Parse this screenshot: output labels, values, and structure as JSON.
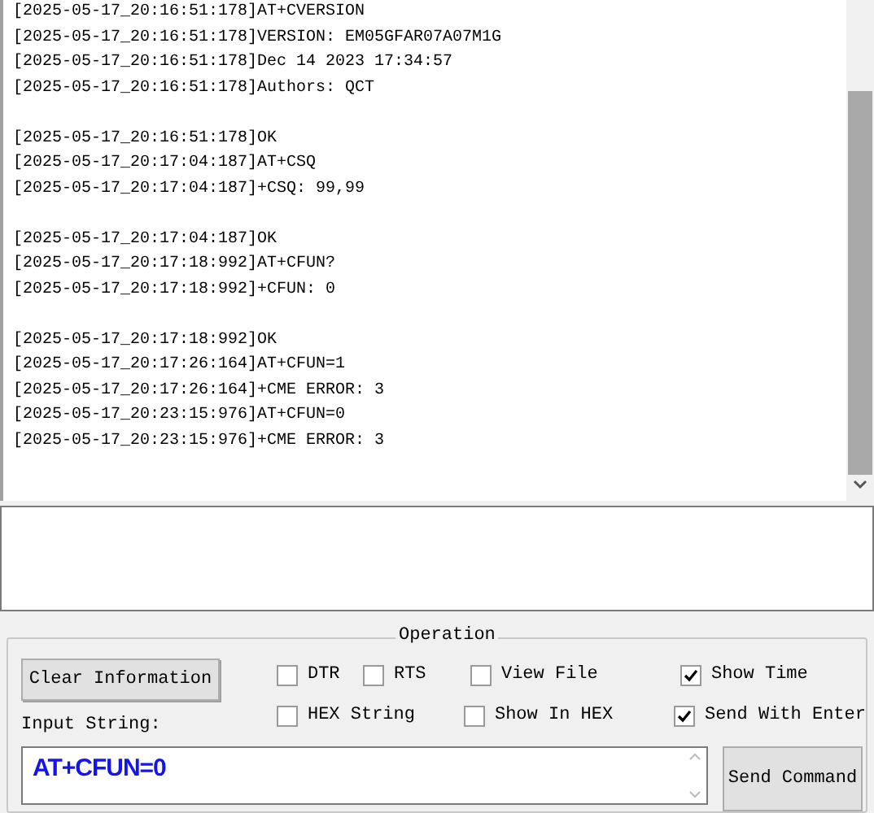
{
  "log": {
    "groups": [
      [
        "[2025-05-17_20:16:51:178]AT+CVERSION",
        "[2025-05-17_20:16:51:178]VERSION: EM05GFAR07A07M1G",
        "[2025-05-17_20:16:51:178]Dec 14 2023 17:34:57",
        "[2025-05-17_20:16:51:178]Authors: QCT"
      ],
      [
        "[2025-05-17_20:16:51:178]OK",
        "[2025-05-17_20:17:04:187]AT+CSQ",
        "[2025-05-17_20:17:04:187]+CSQ: 99,99"
      ],
      [
        "[2025-05-17_20:17:04:187]OK",
        "[2025-05-17_20:17:18:992]AT+CFUN?",
        "[2025-05-17_20:17:18:992]+CFUN: 0"
      ],
      [
        "[2025-05-17_20:17:18:992]OK",
        "[2025-05-17_20:17:26:164]AT+CFUN=1",
        "[2025-05-17_20:17:26:164]+CME ERROR: 3",
        "[2025-05-17_20:23:15:976]AT+CFUN=0",
        "[2025-05-17_20:23:15:976]+CME ERROR: 3"
      ]
    ]
  },
  "operation": {
    "title": "Operation",
    "clear_button": "Clear Information",
    "input_label": "Input String:",
    "input_value": "AT+CFUN=0",
    "send_button": "Send Command",
    "options": [
      {
        "label": "DTR",
        "checked": false
      },
      {
        "label": "RTS",
        "checked": false
      },
      {
        "label": "View File",
        "checked": false
      },
      {
        "label": "Show Time",
        "checked": true
      },
      {
        "label": "HEX String",
        "checked": false
      },
      {
        "label": "Show In HEX",
        "checked": false
      },
      {
        "label": "Send With Enter",
        "checked": true
      }
    ]
  }
}
